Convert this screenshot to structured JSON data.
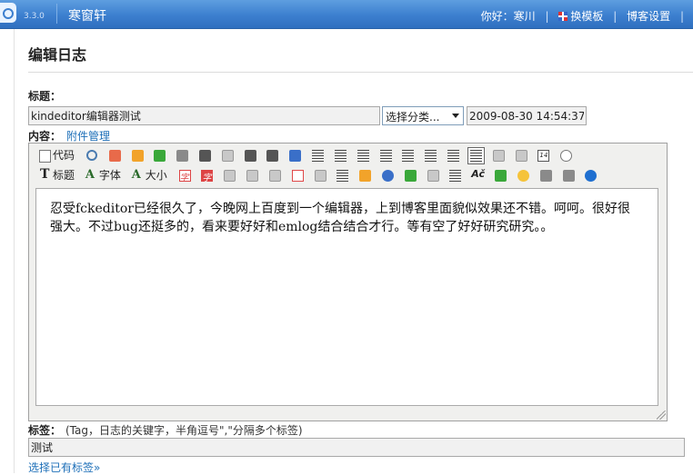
{
  "header": {
    "version": "3.3.0",
    "site_name": "寒窗轩",
    "greeting": "你好：寒川",
    "change_template": "换模板",
    "blog_settings": "博客设置",
    "separator": "|"
  },
  "page": {
    "title": "编辑日志"
  },
  "form": {
    "title_label": "标题：",
    "title_value": "kindeditor编辑器测试",
    "category_selected": "选择分类...",
    "date_value": "2009-08-30 14:54:37",
    "content_label": "内容：",
    "attachment_link": "附件管理"
  },
  "toolbar": {
    "source_label": "代码",
    "heading_label": "标题",
    "font_label": "字体",
    "size_label": "大小"
  },
  "editor": {
    "content": "忍受fckeditor已经很久了，今晚网上百度到一个编辑器，上到博客里面貌似效果还不错。呵呵。很好很强大。不过bug还挺多的，看来要好好和emlog结合结合才行。等有空了好好研究研究。。"
  },
  "tags": {
    "label": "标签：",
    "hint": "(Tag，日志的关键字，半角逗号\",\"分隔多个标签)",
    "value": "测试",
    "choose_link": "选择已有标签»"
  },
  "colors": {
    "topbar": "#3c7fcf",
    "link": "#1d6fb8"
  }
}
